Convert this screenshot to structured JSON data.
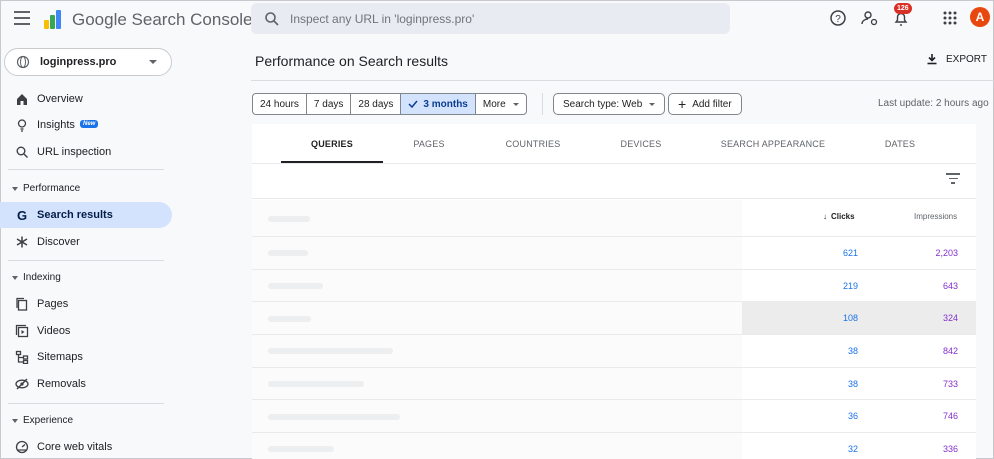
{
  "app": {
    "title": "Google Search Console",
    "search_placeholder": "Inspect any URL in 'loginpress.pro'",
    "notification_count": "126",
    "avatar_letter": "A"
  },
  "property": {
    "name": "loginpress.pro"
  },
  "sidebar": {
    "items_top": [
      {
        "label": "Overview",
        "icon": "home-icon"
      },
      {
        "label": "Insights",
        "icon": "lightbulb-icon",
        "badge": "New"
      },
      {
        "label": "URL inspection",
        "icon": "search-icon"
      }
    ],
    "sections": [
      {
        "label": "Performance",
        "items": [
          {
            "label": "Search results",
            "icon": "google-g-icon",
            "active": true
          },
          {
            "label": "Discover",
            "icon": "asterisk-icon"
          }
        ]
      },
      {
        "label": "Indexing",
        "items": [
          {
            "label": "Pages",
            "icon": "pages-icon"
          },
          {
            "label": "Videos",
            "icon": "videos-icon"
          },
          {
            "label": "Sitemaps",
            "icon": "sitemap-icon"
          },
          {
            "label": "Removals",
            "icon": "removals-icon"
          }
        ]
      },
      {
        "label": "Experience",
        "items": [
          {
            "label": "Core web vitals",
            "icon": "gauge-icon"
          }
        ]
      }
    ]
  },
  "main": {
    "title": "Performance on Search results",
    "export_label": "EXPORT",
    "date_ranges": [
      "24 hours",
      "7 days",
      "28 days",
      "3 months",
      "More"
    ],
    "selected_range": "3 months",
    "search_type": "Search type: Web",
    "add_filter": "Add filter",
    "last_update": "Last update: 2 hours ago",
    "tabs": [
      "QUERIES",
      "PAGES",
      "COUNTRIES",
      "DEVICES",
      "SEARCH APPEARANCE",
      "DATES"
    ],
    "active_tab": "QUERIES",
    "table": {
      "col_clicks": "Clicks",
      "col_impressions": "Impressions",
      "rows": [
        {
          "clicks": "621",
          "impressions": "2,203"
        },
        {
          "clicks": "219",
          "impressions": "643"
        },
        {
          "clicks": "108",
          "impressions": "324"
        },
        {
          "clicks": "38",
          "impressions": "842"
        },
        {
          "clicks": "38",
          "impressions": "733"
        },
        {
          "clicks": "36",
          "impressions": "746"
        },
        {
          "clicks": "32",
          "impressions": "336"
        }
      ]
    }
  },
  "colors": {
    "accent": "#1a73e8",
    "active_bg": "#d3e3fd",
    "impressions": "#8430ce",
    "badge": "#d93025",
    "avatar": "#e8470f"
  }
}
